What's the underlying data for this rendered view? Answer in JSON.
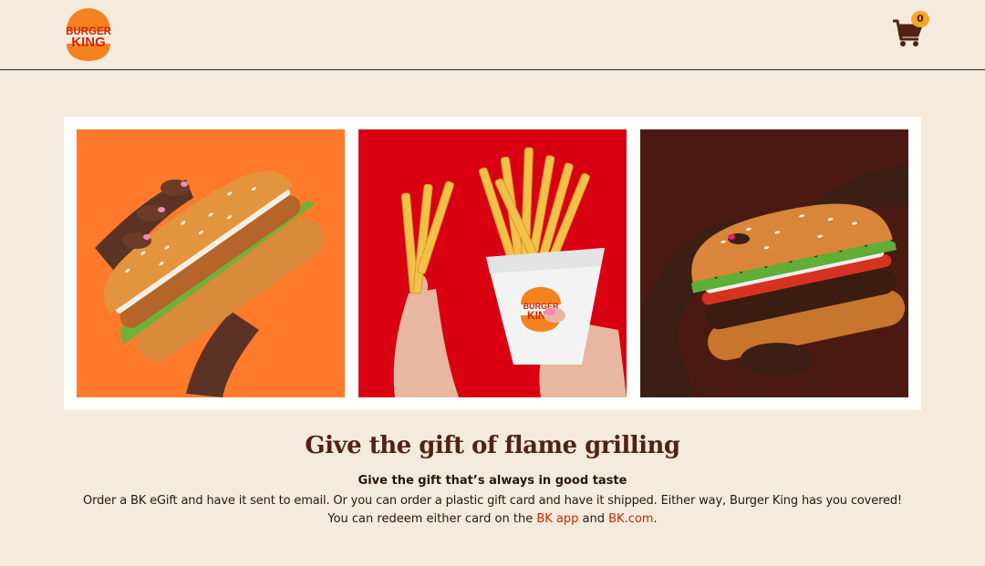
{
  "header": {
    "logo_top": "BURGER",
    "logo_bottom": "KING",
    "cart_count": "0",
    "cart_icon": "shopping-cart-icon"
  },
  "gallery": {
    "colors": {
      "panel_1": "#ff7a2b",
      "panel_2": "#d90012",
      "panel_3": "#4a1a12"
    },
    "images": [
      "chicken-sandwich-image",
      "french-fries-image",
      "whopper-image"
    ],
    "fries_box_logo_top": "BURGER",
    "fries_box_logo_bottom": "KING"
  },
  "content": {
    "title": "Give the gift of flame grilling",
    "subtitle": "Give the gift that’s always in good taste",
    "line1": "Order a BK eGift and have it sent to email. Or you can order a plastic gift card and have it shipped. Either way, Burger King has you covered!",
    "line2_prefix": "You can redeem either card on the ",
    "link_app": "BK app",
    "line2_middle": " and ",
    "link_site": "BK.com",
    "line2_suffix": "."
  },
  "brand_colors": {
    "background": "#f5ebdc",
    "text": "#502314",
    "link": "#d62300",
    "badge": "#f5a623"
  }
}
